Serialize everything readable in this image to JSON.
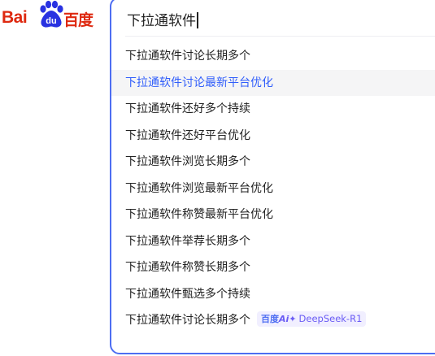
{
  "logo": {
    "text_latin": "Bai",
    "paw_text": "du",
    "text_cn": "百度",
    "brand_color": "#de2910",
    "paw_color": "#2932e1"
  },
  "search": {
    "query": "下拉通软件"
  },
  "suggestions": [
    {
      "prefix": "下拉通软件",
      "suffix": "讨论长期多个",
      "active": false
    },
    {
      "prefix": "下拉通软件",
      "suffix": "讨论最新平台优化",
      "active": true
    },
    {
      "prefix": "下拉通软件",
      "suffix": "还好多个持续",
      "active": false
    },
    {
      "prefix": "下拉通软件",
      "suffix": "还好平台优化",
      "active": false
    },
    {
      "prefix": "下拉通软件",
      "suffix": "浏览长期多个",
      "active": false
    },
    {
      "prefix": "下拉通软件",
      "suffix": "浏览最新平台优化",
      "active": false
    },
    {
      "prefix": "下拉通软件",
      "suffix": "称赞最新平台优化",
      "active": false
    },
    {
      "prefix": "下拉通软件",
      "suffix": "举荐长期多个",
      "active": false
    },
    {
      "prefix": "下拉通软件",
      "suffix": "称赞长期多个",
      "active": false
    },
    {
      "prefix": "下拉通软件",
      "suffix": "甄选多个持续",
      "active": false
    },
    {
      "prefix": "下拉通软件",
      "suffix": "讨论长期多个",
      "active": false
    }
  ],
  "ai_badge": {
    "brand": "百度",
    "ai": "Ai✦",
    "model": "DeepSeek-R1"
  },
  "colors": {
    "accent": "#4e6ef2",
    "active_text": "#315efb",
    "active_bg": "#f5f5f6",
    "text": "#222222"
  }
}
